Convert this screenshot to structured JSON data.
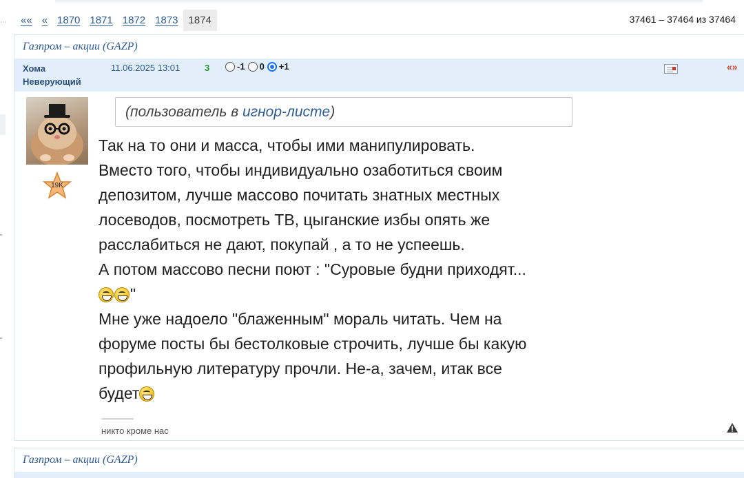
{
  "pager": {
    "first": "««",
    "prev": "«",
    "pages": [
      "1870",
      "1871",
      "1872",
      "1873"
    ],
    "current": "1874",
    "range": "37461 – 37464 из 37464"
  },
  "post1": {
    "forum": "Газпром – акции (GAZP)",
    "user_line1": "Хома",
    "user_line2": "Неверующий",
    "date": "11.06.2025 13:01",
    "rating": "3",
    "votes": [
      "-1",
      "0",
      "+1"
    ],
    "selected_vote": "+1",
    "quote": "«»",
    "badge": "19K",
    "ignored_prefix": "(пользователь в ",
    "ignored_link": "игнор-листе",
    "ignored_suffix": ")",
    "lines": [
      "Так на то они и масса, чтобы ими манипулировать.",
      "Вместо того, чтобы индивидуально озаботиться своим",
      "депозитом, лучше массово почитать знатных местных",
      "лосеводов, посмотреть ТВ, цыганские избы опять же",
      "расслабиться не дают, покупай , а то не успеешь.",
      "А потом массово песни поют : \"Суровые будни приходят...",
      "\"",
      "Мне уже надоело \"блаженным\" мораль читать. Чем на",
      "форуме посты бы бестолковые строчить, лучше бы какую",
      "профильную литературу прочли. Не-а, зачем, итак все",
      "будет"
    ],
    "sig_line": "--------------------",
    "signature": "никто кроме нас"
  },
  "post2": {
    "forum": "Газпром – акции (GAZP)"
  },
  "icons": {
    "message": "message-icon",
    "warning": "warning-icon",
    "emoji": "grin-emoji-icon"
  },
  "colors": {
    "link": "#2d5b93",
    "meta_bg": "#e2eefa",
    "rating_green": "#28942b",
    "quote_red": "#d6402b"
  }
}
